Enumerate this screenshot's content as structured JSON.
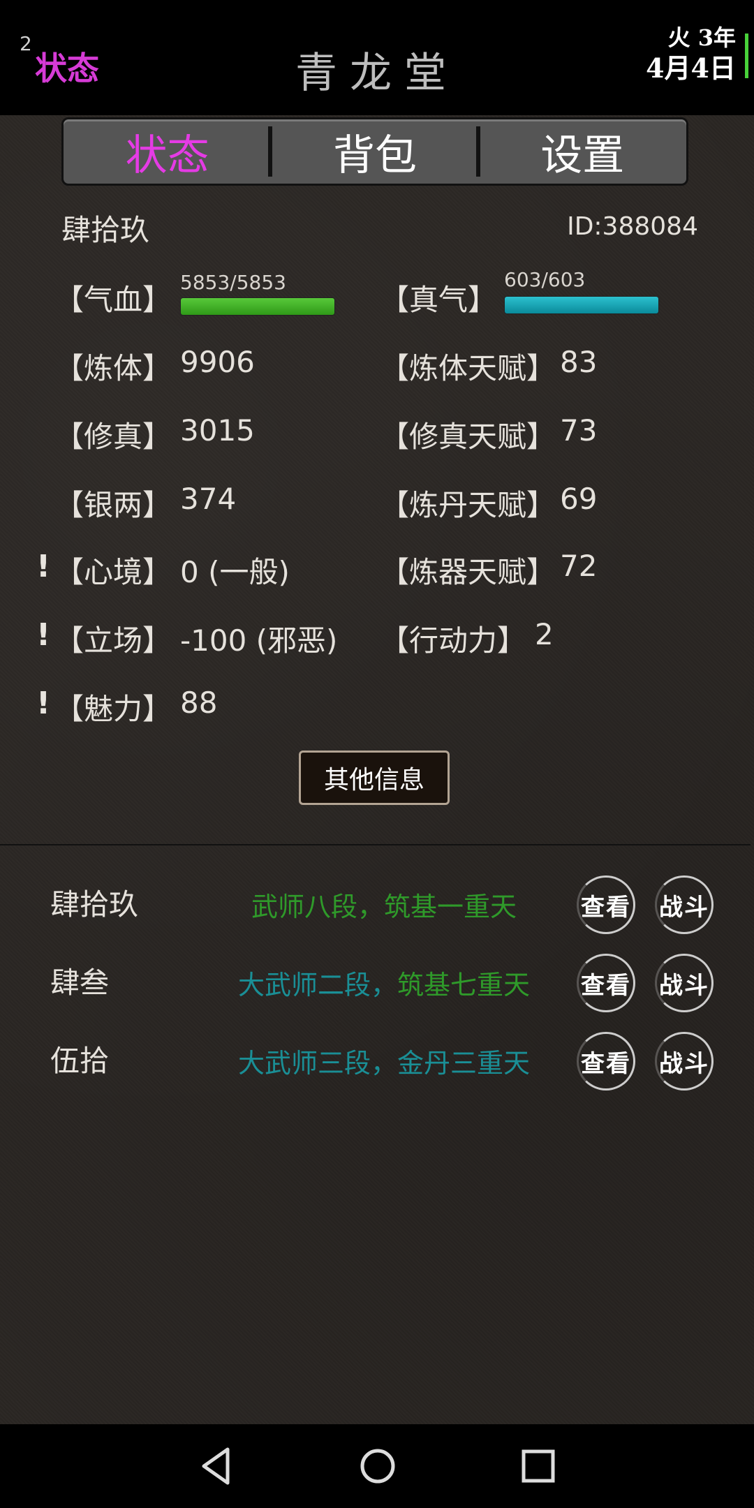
{
  "top_bar": {
    "badge": "2",
    "mode": "状态",
    "title": "青龙堂",
    "time_line1": "火 3年",
    "time_line2": "4月4日"
  },
  "tabs": [
    {
      "label": "状态",
      "active": true
    },
    {
      "label": "背包",
      "active": false
    },
    {
      "label": "设置",
      "active": false
    }
  ],
  "player": {
    "name": "肆拾玖",
    "id": "ID:388084"
  },
  "vitals": {
    "hp_label": "【气血】",
    "hp_value": "5853/5853",
    "hp_ratio": 1.0,
    "mp_label": "【真气】",
    "mp_value": "603/603",
    "mp_ratio": 1.0
  },
  "stats_left": [
    {
      "label": "【炼体】",
      "value": "9906",
      "warn": false
    },
    {
      "label": "【修真】",
      "value": "3015",
      "warn": false
    },
    {
      "label": "【银两】",
      "value": "374",
      "warn": false
    },
    {
      "label": "【心境】",
      "value": "0 (一般)",
      "warn": true
    },
    {
      "label": "【立场】",
      "value": "-100 (邪恶)",
      "warn": true
    },
    {
      "label": "【魅力】",
      "value": "88",
      "warn": true
    }
  ],
  "stats_right": [
    {
      "label": "【炼体天赋】",
      "value": "83"
    },
    {
      "label": "【修真天赋】",
      "value": "73"
    },
    {
      "label": "【炼丹天赋】",
      "value": "69"
    },
    {
      "label": "【炼器天赋】",
      "value": "72"
    },
    {
      "label": "【行动力】",
      "value": "2"
    }
  ],
  "warn_mark": "!",
  "more_info_label": "其他信息",
  "npcs": [
    {
      "name": "肆拾玖",
      "rank_a": "武师八段",
      "sep": "，",
      "rank_b": "筑基一重天",
      "color_a": "#2f9a2a",
      "color_b": "#2f9a2a"
    },
    {
      "name": "肆叁",
      "rank_a": "大武师二段",
      "sep": "，",
      "rank_b": "筑基七重天",
      "color_a": "#1a8f96",
      "color_b": "#2f9a2a"
    },
    {
      "name": "伍拾",
      "rank_a": "大武师三段",
      "sep": "，",
      "rank_b": "金丹三重天",
      "color_a": "#1a8f96",
      "color_b": "#1a8f96"
    }
  ],
  "npc_actions": {
    "view": "查看",
    "fight": "战斗"
  },
  "nav": {
    "back": "back-icon",
    "home": "home-icon",
    "recents": "recents-icon"
  }
}
